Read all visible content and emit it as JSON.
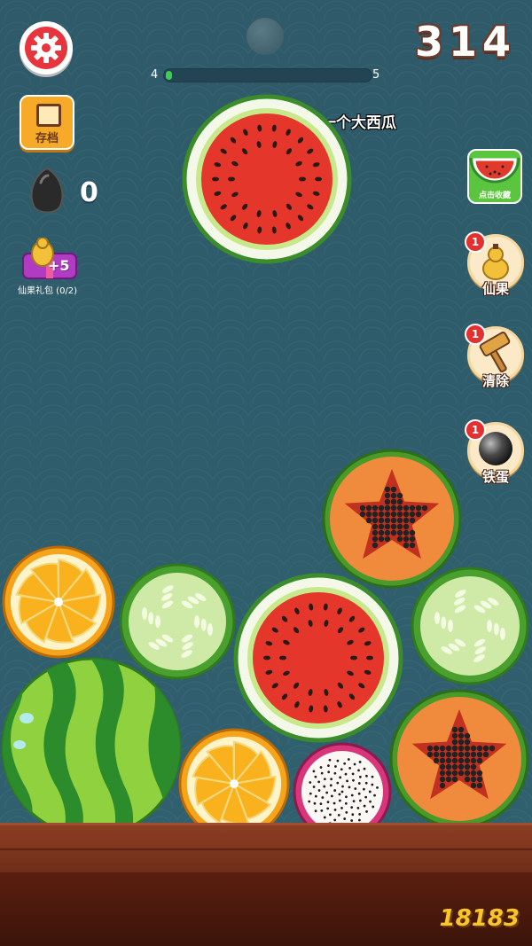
{
  "hud": {
    "score": "314",
    "level_current": "4",
    "level_next": "5",
    "level_progress": 0.03,
    "seed_count": "0",
    "next_fruit_label": "一个大西瓜",
    "save_label": "存档",
    "gift_plus": "+5",
    "gift_label": "仙果礼包 (0/2)"
  },
  "tools": {
    "collect_label": "点击收藏",
    "items": [
      {
        "label": "仙果",
        "badge": "1",
        "icon": "gourd-icon"
      },
      {
        "label": "清除",
        "badge": "1",
        "icon": "hammer-icon"
      },
      {
        "label": "铁蛋",
        "badge": "1",
        "icon": "iron-ball-icon"
      }
    ]
  },
  "fruits": [
    {
      "type": "watermelon-slice",
      "role": "held"
    },
    {
      "type": "orange"
    },
    {
      "type": "cucumber"
    },
    {
      "type": "watermelon-slice"
    },
    {
      "type": "papaya"
    },
    {
      "type": "cucumber"
    },
    {
      "type": "whole-watermelon"
    },
    {
      "type": "orange"
    },
    {
      "type": "dragon-fruit"
    },
    {
      "type": "papaya"
    }
  ],
  "watermark": "18183",
  "colors": {
    "settings": "#e8343c",
    "score_outline": "#6b3c2b",
    "table": "#7a3320",
    "badge": "#e53030"
  }
}
